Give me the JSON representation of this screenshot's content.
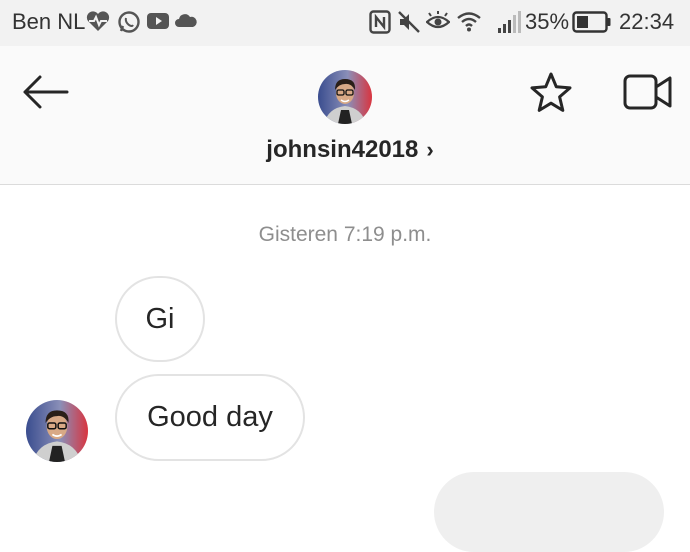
{
  "status_bar": {
    "carrier": "Ben NL",
    "battery_percent": "35%",
    "time": "22:34"
  },
  "header": {
    "username": "johnsin42018",
    "username_chevron": "›"
  },
  "conversation": {
    "timestamp": "Gisteren 7:19 p.m.",
    "messages": [
      {
        "from": "other",
        "text": "Gi"
      },
      {
        "from": "other",
        "text": "Good day"
      }
    ]
  },
  "icons": {
    "back": "arrow-left-icon",
    "favorite": "star-icon",
    "video_call": "video-camera-icon"
  },
  "colors": {
    "header_bg": "#fafafa",
    "status_bar_bg": "#f2f2f2",
    "muted_text": "#8e8e8e",
    "bubble_border": "#e3e3e3",
    "outgoing_bubble": "#efefef"
  }
}
